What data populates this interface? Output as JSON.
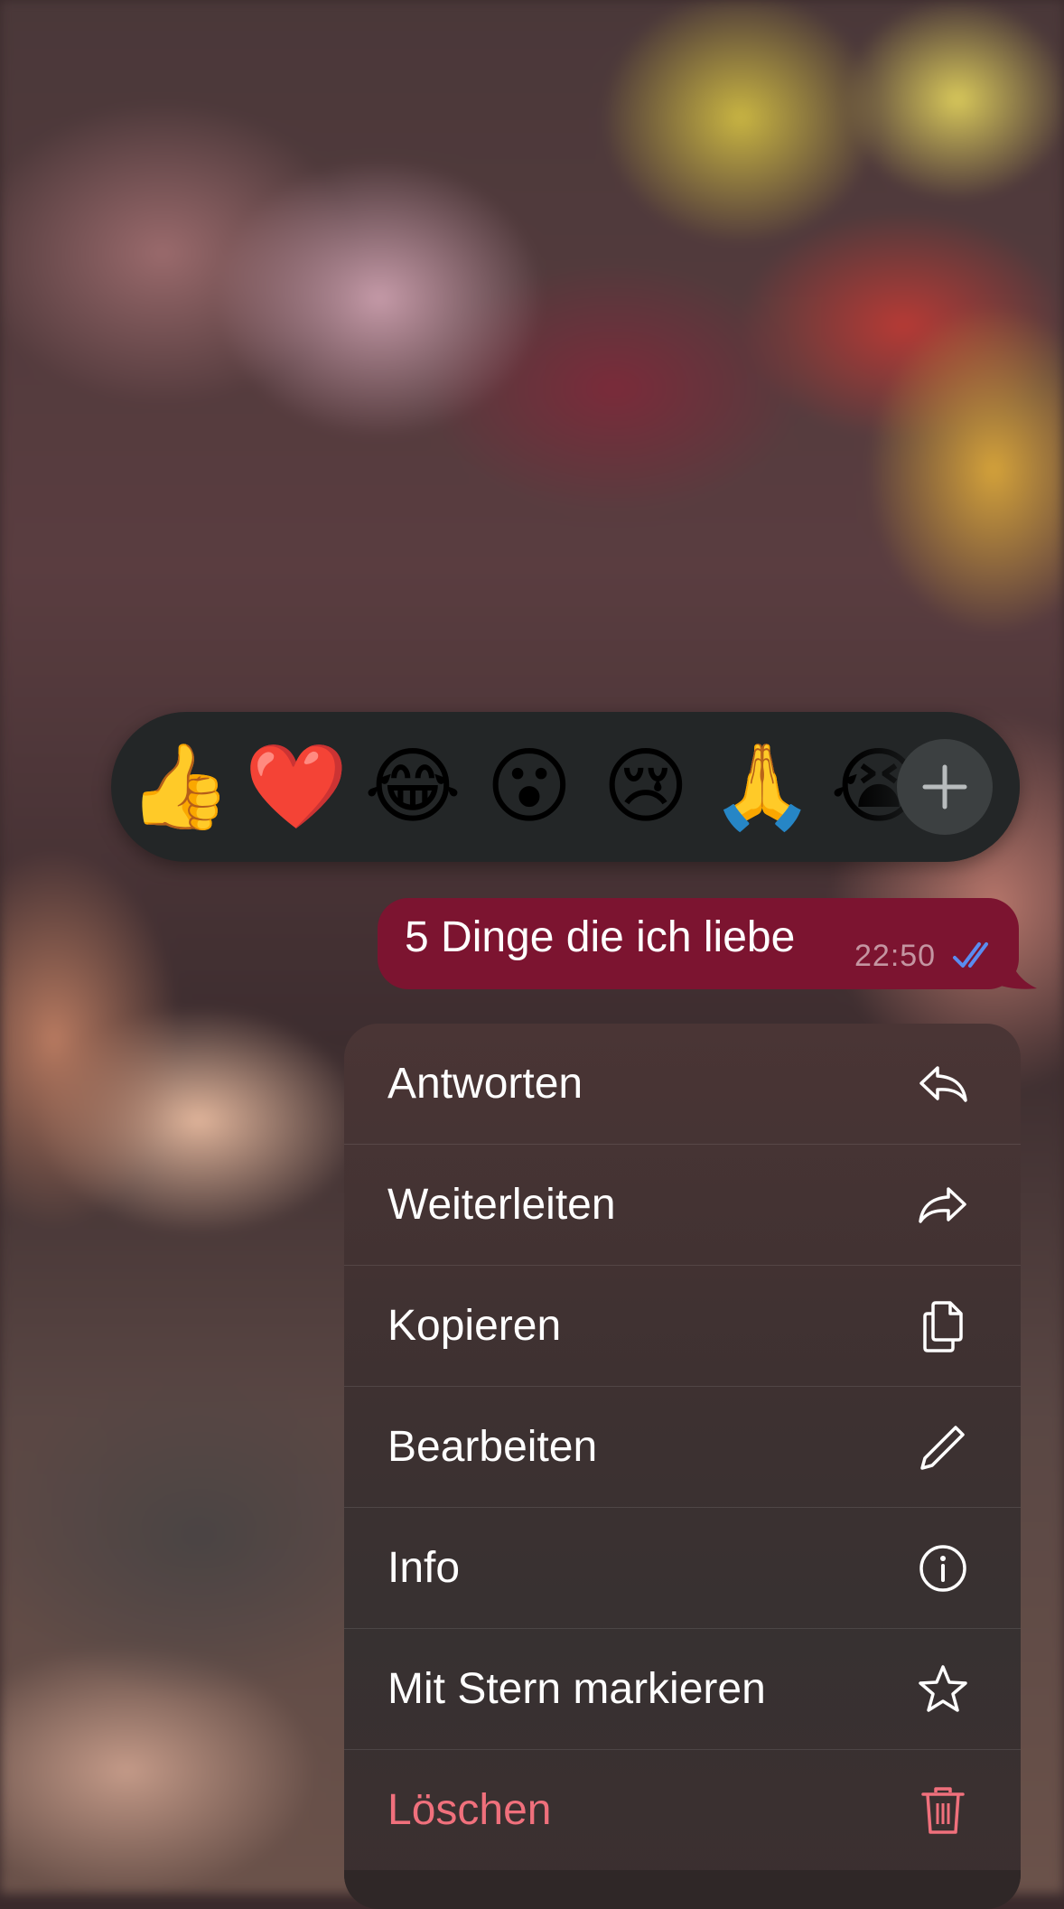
{
  "reactions": {
    "emojis": [
      {
        "glyph": "👍",
        "name": "thumbs-up"
      },
      {
        "glyph": "❤️",
        "name": "red-heart"
      },
      {
        "glyph": "😂",
        "name": "tears-of-joy"
      },
      {
        "glyph": "😮",
        "name": "open-mouth"
      },
      {
        "glyph": "😢",
        "name": "crying-face"
      },
      {
        "glyph": "🙏",
        "name": "folded-hands"
      },
      {
        "glyph": "😭",
        "name": "loudly-crying"
      }
    ],
    "more_icon": "plus-icon"
  },
  "message": {
    "text": "5 Dinge die ich liebe",
    "time": "22:50",
    "status_icon": "double-check-icon",
    "bubble_color": "#7c1430",
    "status_color": "#5a8cf0"
  },
  "menu": {
    "items": [
      {
        "label": "Antworten",
        "icon": "reply-icon"
      },
      {
        "label": "Weiterleiten",
        "icon": "forward-icon"
      },
      {
        "label": "Kopieren",
        "icon": "copy-icon"
      },
      {
        "label": "Bearbeiten",
        "icon": "pencil-icon"
      },
      {
        "label": "Info",
        "icon": "info-icon"
      },
      {
        "label": "Mit Stern markieren",
        "icon": "star-icon"
      },
      {
        "label": "Löschen",
        "icon": "trash-icon",
        "danger_color": "#f0707c"
      }
    ]
  }
}
